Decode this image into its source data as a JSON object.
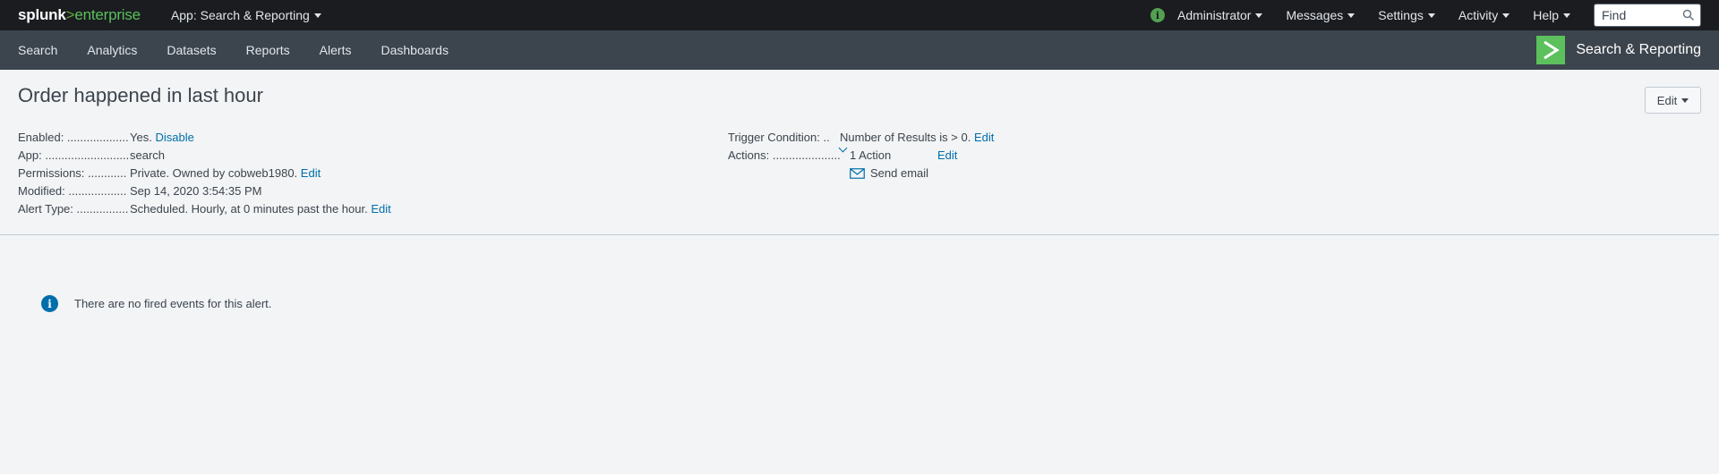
{
  "topbar": {
    "logo": {
      "part1": "splunk",
      "part2": ">",
      "part3": "enterprise"
    },
    "app_menu": "App: Search & Reporting",
    "status_icon": "info-icon",
    "items": [
      {
        "label": "Administrator"
      },
      {
        "label": "Messages"
      },
      {
        "label": "Settings"
      },
      {
        "label": "Activity"
      },
      {
        "label": "Help"
      }
    ],
    "find_placeholder": "Find"
  },
  "navbar": {
    "items": [
      {
        "label": "Search"
      },
      {
        "label": "Analytics"
      },
      {
        "label": "Datasets"
      },
      {
        "label": "Reports"
      },
      {
        "label": "Alerts"
      },
      {
        "label": "Dashboards"
      }
    ],
    "app_title": "Search & Reporting"
  },
  "alert": {
    "title": "Order happened in last hour",
    "edit_label": "Edit",
    "left": {
      "enabled_key": "Enabled: ...................",
      "enabled_val": "Yes.",
      "enabled_link": "Disable",
      "app_key": "App: ..........................",
      "app_val": "search",
      "permissions_key": "Permissions: ............",
      "permissions_val": "Private. Owned by cobweb1980.",
      "permissions_link": "Edit",
      "modified_key": "Modified: ..................",
      "modified_val": "Sep 14, 2020 3:54:35 PM",
      "alert_type_key": "Alert Type: ................",
      "alert_type_val": "Scheduled. Hourly, at 0 minutes past the hour.",
      "alert_type_link": "Edit"
    },
    "right": {
      "trigger_key": "Trigger Condition: ..",
      "trigger_val": "Number of Results is > 0.",
      "trigger_link": "Edit",
      "actions_key": "Actions: .....................",
      "actions_val": "1 Action",
      "actions_link": "Edit",
      "send_email": "Send email"
    }
  },
  "notice": {
    "text": "There are no fired events for this alert."
  },
  "colors": {
    "topbar_bg": "#1a1c20",
    "navbar_bg": "#3c444d",
    "accent_green": "#5cc05c",
    "link_blue": "#006eaa",
    "page_bg": "#f2f4f5"
  }
}
